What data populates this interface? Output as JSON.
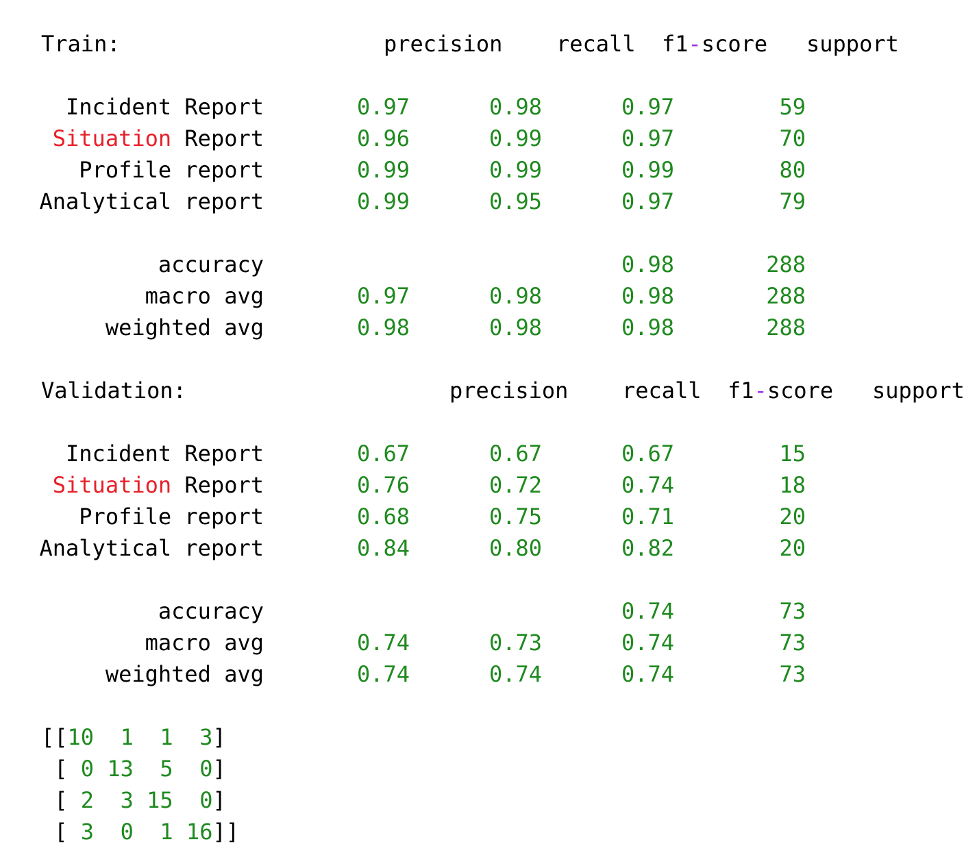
{
  "train": {
    "heading": "Train:",
    "header": {
      "precision": "precision",
      "recall": "recall",
      "f1_prefix": "f1",
      "f1_dash": "-",
      "f1_suffix": "score",
      "support": "support"
    },
    "rows": [
      {
        "label_a": "Incident",
        "label_b": "Report",
        "precision": "0.97",
        "recall": "0.98",
        "f1": "0.97",
        "support": "59"
      },
      {
        "label_a": "Situation",
        "label_b": "Report",
        "precision": "0.96",
        "recall": "0.99",
        "f1": "0.97",
        "support": "70"
      },
      {
        "label_a": "Profile",
        "label_b": "report",
        "precision": "0.99",
        "recall": "0.99",
        "f1": "0.99",
        "support": "80"
      },
      {
        "label_a": "Analytical",
        "label_b": "report",
        "precision": "0.99",
        "recall": "0.95",
        "f1": "0.97",
        "support": "79"
      }
    ],
    "summary": [
      {
        "label": "accuracy",
        "precision": "",
        "recall": "",
        "f1": "0.98",
        "support": "288"
      },
      {
        "label": "macro avg",
        "precision": "0.97",
        "recall": "0.98",
        "f1": "0.98",
        "support": "288"
      },
      {
        "label": "weighted avg",
        "precision": "0.98",
        "recall": "0.98",
        "f1": "0.98",
        "support": "288"
      }
    ]
  },
  "validation": {
    "heading": "Validation:",
    "header": {
      "precision": "precision",
      "recall": "recall",
      "f1_prefix": "f1",
      "f1_dash": "-",
      "f1_suffix": "score",
      "support": "support"
    },
    "rows": [
      {
        "label_a": "Incident",
        "label_b": "Report",
        "precision": "0.67",
        "recall": "0.67",
        "f1": "0.67",
        "support": "15"
      },
      {
        "label_a": "Situation",
        "label_b": "Report",
        "precision": "0.76",
        "recall": "0.72",
        "f1": "0.74",
        "support": "18"
      },
      {
        "label_a": "Profile",
        "label_b": "report",
        "precision": "0.68",
        "recall": "0.75",
        "f1": "0.71",
        "support": "20"
      },
      {
        "label_a": "Analytical",
        "label_b": "report",
        "precision": "0.84",
        "recall": "0.80",
        "f1": "0.82",
        "support": "20"
      }
    ],
    "summary": [
      {
        "label": "accuracy",
        "precision": "",
        "recall": "",
        "f1": "0.74",
        "support": "73"
      },
      {
        "label": "macro avg",
        "precision": "0.74",
        "recall": "0.73",
        "f1": "0.74",
        "support": "73"
      },
      {
        "label": "weighted avg",
        "precision": "0.74",
        "recall": "0.74",
        "f1": "0.74",
        "support": "73"
      }
    ]
  },
  "confusion_matrix": {
    "rows": [
      [
        "10",
        "1",
        "1",
        "3"
      ],
      [
        "0",
        "13",
        "5",
        "0"
      ],
      [
        "2",
        "3",
        "15",
        "0"
      ],
      [
        "3",
        "0",
        "1",
        "16"
      ]
    ]
  },
  "colors": {
    "number": "#1f8a1f",
    "keyword": "#e8202a",
    "operator": "#9b30f0",
    "text": "#000000"
  }
}
